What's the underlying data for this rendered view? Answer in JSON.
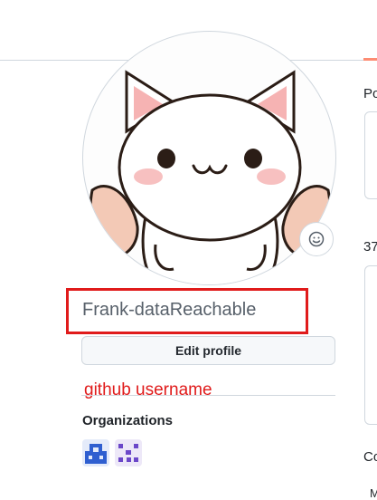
{
  "profile": {
    "username": "Frank-dataReachable",
    "edit_label": "Edit profile",
    "annotation": "github username",
    "annotation_color": "#e01b1b",
    "avatar": "cat-avatar",
    "status_icon": "smiley-icon"
  },
  "organizations": {
    "heading": "Organizations",
    "items": [
      {
        "icon": "org-icon-blue",
        "color": "#2f5fd0"
      },
      {
        "icon": "org-icon-purple",
        "color": "#6b47c9"
      }
    ]
  },
  "right_column": {
    "label_1": "Po",
    "label_2": "37",
    "label_3": "Co",
    "label_4": "M"
  }
}
